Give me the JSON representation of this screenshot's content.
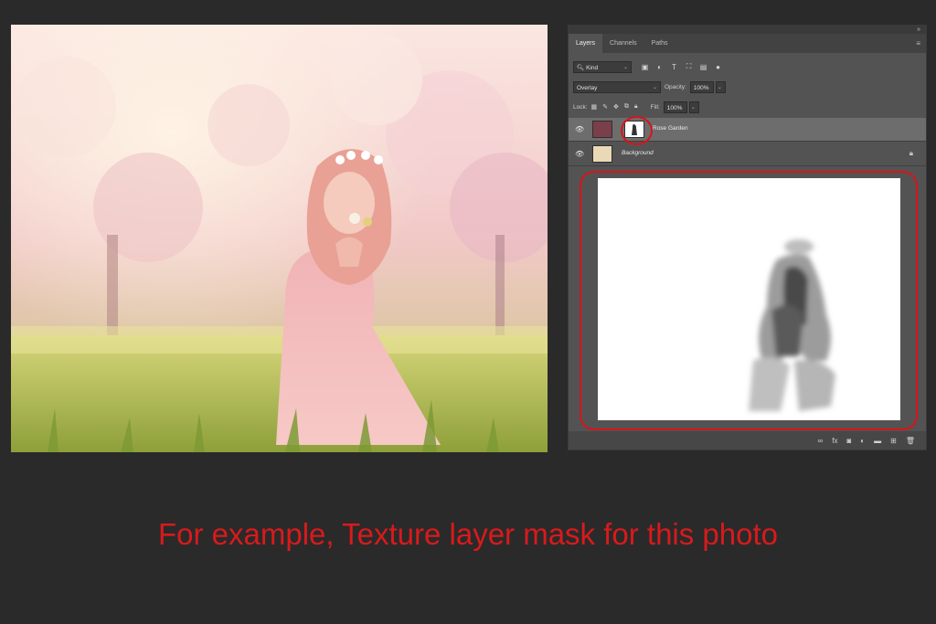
{
  "panel": {
    "tabs": [
      {
        "label": "Layers",
        "active": true
      },
      {
        "label": "Channels",
        "active": false
      },
      {
        "label": "Paths",
        "active": false
      }
    ],
    "filter": {
      "kind_value": "Kind"
    },
    "blend": {
      "mode_value": "Overlay",
      "opacity_label": "Opacity:",
      "opacity_value": "100%"
    },
    "lock": {
      "label": "Lock:",
      "fill_label": "Fill:",
      "fill_value": "100%"
    },
    "layers": [
      {
        "name": "Rose Garden",
        "selected": true,
        "has_mask": true
      },
      {
        "name": "Background",
        "selected": false,
        "locked": true
      }
    ]
  },
  "caption": "For example, Texture layer mask for this photo",
  "colors": {
    "accent": "#d8141b",
    "background": "#2a2a2a",
    "panel": "#535353"
  },
  "icons": {
    "filter": [
      "image-filter-icon",
      "adjustment-filter-icon",
      "type-filter-icon",
      "shape-filter-icon",
      "smart-object-filter-icon"
    ],
    "lock": [
      "lock-transparent-icon",
      "lock-image-icon",
      "lock-position-icon",
      "lock-artboard-icon",
      "lock-all-icon"
    ],
    "bottom": [
      "link-icon",
      "fx-icon",
      "mask-icon",
      "adjustment-icon",
      "folder-icon",
      "new-layer-icon",
      "trash-icon"
    ]
  }
}
